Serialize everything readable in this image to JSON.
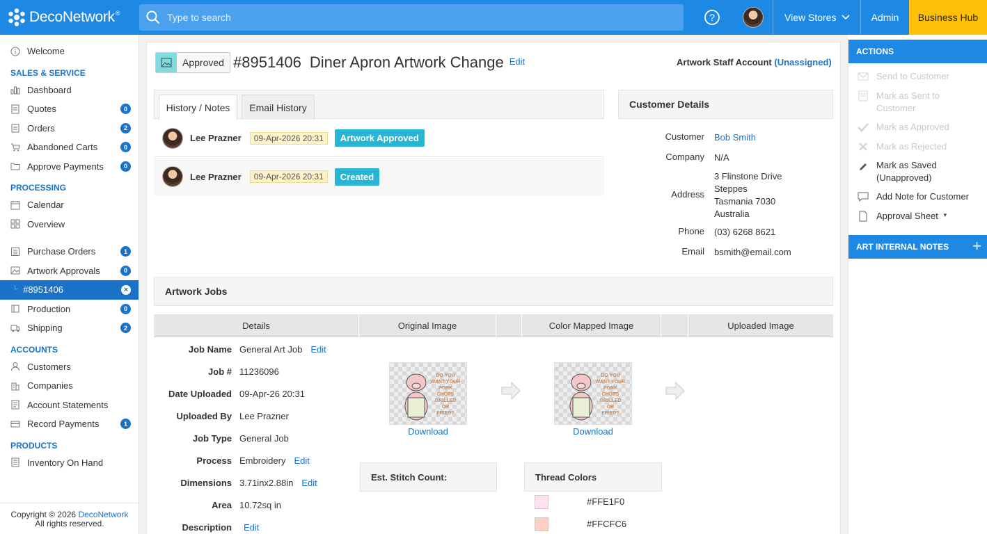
{
  "app": {
    "name": "DecoNetwork",
    "trademark": "®"
  },
  "header": {
    "search_placeholder": "Type to search",
    "view_stores": "View Stores",
    "admin": "Admin",
    "business_hub": "Business Hub"
  },
  "sidebar": {
    "welcome": "Welcome",
    "sections": {
      "sales": "SALES & SERVICE",
      "processing": "PROCESSING",
      "accounts": "ACCOUNTS",
      "products": "PRODUCTS"
    },
    "items": {
      "dashboard": "Dashboard",
      "quotes": {
        "label": "Quotes",
        "count": "0"
      },
      "orders": {
        "label": "Orders",
        "count": "2"
      },
      "abandoned": {
        "label": "Abandoned Carts",
        "count": "0"
      },
      "approve_payments": {
        "label": "Approve Payments",
        "count": "0"
      },
      "calendar": "Calendar",
      "overview": "Overview",
      "purchase_orders": {
        "label": "Purchase Orders",
        "count": "1"
      },
      "artwork_approvals": {
        "label": "Artwork Approvals",
        "count": "0"
      },
      "current": "#8951406",
      "production": {
        "label": "Production",
        "count": "0"
      },
      "shipping": {
        "label": "Shipping",
        "count": "2"
      },
      "customers": "Customers",
      "companies": "Companies",
      "account_statements": "Account Statements",
      "record_payments": {
        "label": "Record Payments",
        "count": "1"
      },
      "inventory": "Inventory On Hand"
    },
    "copyright_prefix": "Copyright © 2026 ",
    "copyright_link": "DecoNetwork",
    "rights": "All rights reserved."
  },
  "artwork": {
    "status": "Approved",
    "number": "#8951406",
    "name": "Diner Apron Artwork Change",
    "edit": "Edit",
    "staff_label": "Artwork Staff Account",
    "staff_value": "(Unassigned)"
  },
  "tabs": [
    "History / Notes",
    "Email History"
  ],
  "history": [
    {
      "user": "Lee Prazner",
      "date": "09-Apr-2026 20:31",
      "event": "Artwork Approved"
    },
    {
      "user": "Lee Prazner",
      "date": "09-Apr-2026 20:31",
      "event": "Created"
    }
  ],
  "customer_details": {
    "heading": "Customer Details",
    "customer_label": "Customer",
    "customer": "Bob Smith",
    "company_label": "Company",
    "company": "N/A",
    "address_label": "Address",
    "address": [
      "3 Flinstone Drive",
      "Steppes",
      "Tasmania 7030",
      "Australia"
    ],
    "phone_label": "Phone",
    "phone": "(03) 6268 8621",
    "email_label": "Email",
    "email": "bsmith@email.com"
  },
  "jobs": {
    "heading": "Artwork Jobs",
    "columns": [
      "Details",
      "Original Image",
      "Color Mapped Image",
      "Uploaded Image"
    ],
    "fields": [
      {
        "label": "Job Name",
        "value": "General Art Job",
        "edit": "Edit"
      },
      {
        "label": "Job #",
        "value": "11236096"
      },
      {
        "label": "Date Uploaded",
        "value": "09-Apr-26 20:31"
      },
      {
        "label": "Uploaded By",
        "value": "Lee Prazner"
      },
      {
        "label": "Job Type",
        "value": "General Job"
      },
      {
        "label": "Process",
        "value": "Embroidery",
        "edit": "Edit"
      },
      {
        "label": "Dimensions",
        "value": "3.71inx2.88in",
        "edit": "Edit"
      },
      {
        "label": "Area",
        "value": "10.72sq in"
      },
      {
        "label": "Description",
        "value": "",
        "edit": "Edit"
      }
    ],
    "download": "Download",
    "artwork_text": [
      "DO YOU",
      "WANT YOUR",
      "PORK",
      "CHOPS",
      "GRILLED",
      "OR",
      "FRIED?"
    ],
    "stitch_count_label": "Est. Stitch Count:",
    "thread_colors_label": "Thread Colors",
    "thread_colors": [
      {
        "hex": "#FFE1F0"
      },
      {
        "hex": "#FFCFC6"
      }
    ]
  },
  "actions": {
    "heading": "ACTIONS",
    "send": "Send to Customer",
    "mark_sent": "Mark as Sent to Customer",
    "mark_approved": "Mark as Approved",
    "mark_rejected": "Mark as Rejected",
    "mark_saved": "Mark as Saved (Unapproved)",
    "add_note": "Add Note for Customer",
    "approval_sheet": "Approval Sheet",
    "internal_notes": "ART INTERNAL NOTES"
  },
  "colors": {
    "primary": "#1e88e5",
    "accent": "#ffc107",
    "tag": "#26b5d3"
  }
}
